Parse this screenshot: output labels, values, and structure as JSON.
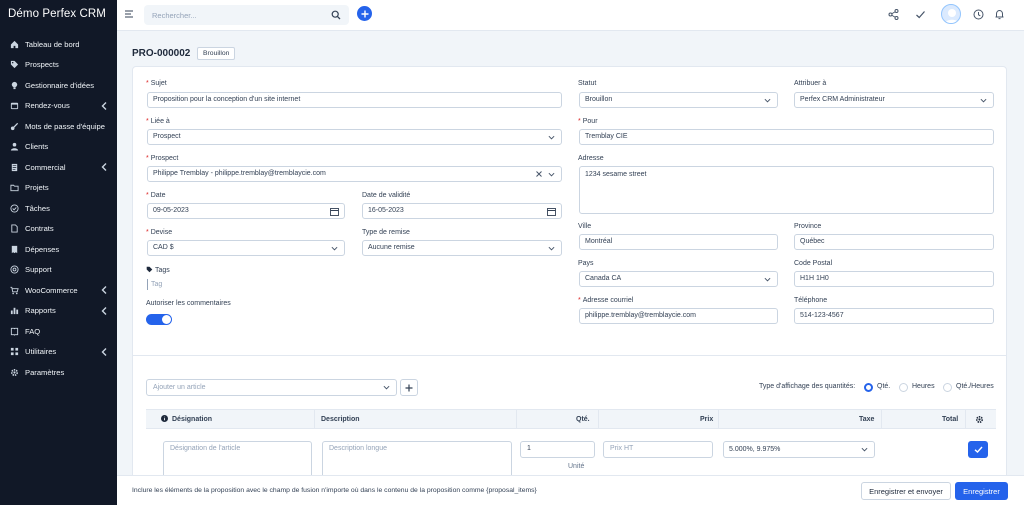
{
  "app": {
    "brand": "Démo Perfex CRM"
  },
  "sidebar": {
    "items": [
      {
        "label": "Tableau de bord",
        "icon": "home-icon",
        "has_sub": false
      },
      {
        "label": "Prospects",
        "icon": "tag-icon",
        "has_sub": false
      },
      {
        "label": "Gestionnaire d'idées",
        "icon": "lightbulb-icon",
        "has_sub": false
      },
      {
        "label": "Rendez-vous",
        "icon": "calendar-icon",
        "has_sub": true
      },
      {
        "label": "Mots de passe d'équipe",
        "icon": "key-icon",
        "has_sub": false
      },
      {
        "label": "Clients",
        "icon": "user-icon",
        "has_sub": false
      },
      {
        "label": "Commercial",
        "icon": "document-icon",
        "has_sub": true
      },
      {
        "label": "Projets",
        "icon": "folder-icon",
        "has_sub": false
      },
      {
        "label": "Tâches",
        "icon": "check-circle-icon",
        "has_sub": false
      },
      {
        "label": "Contrats",
        "icon": "file-icon",
        "has_sub": false
      },
      {
        "label": "Dépenses",
        "icon": "receipt-icon",
        "has_sub": false
      },
      {
        "label": "Support",
        "icon": "lifebuoy-icon",
        "has_sub": false
      },
      {
        "label": "WooCommerce",
        "icon": "cart-icon",
        "has_sub": true
      },
      {
        "label": "Rapports",
        "icon": "chart-icon",
        "has_sub": true
      },
      {
        "label": "FAQ",
        "icon": "book-icon",
        "has_sub": false
      },
      {
        "label": "Utilitaires",
        "icon": "grid-icon",
        "has_sub": true
      },
      {
        "label": "Paramètres",
        "icon": "gear-icon",
        "has_sub": false
      }
    ]
  },
  "topbar": {
    "search_placeholder": "Rechercher...",
    "icons": [
      "menu-icon",
      "search-icon",
      "plus-icon",
      "share-icon",
      "check-icon",
      "avatar",
      "clock-icon",
      "bell-icon"
    ]
  },
  "proposal": {
    "number": "PRO-000002",
    "status_badge": "Brouillon"
  },
  "form": {
    "subject": {
      "label": "Sujet",
      "value": "Proposition pour la conception d'un site internet"
    },
    "related": {
      "label": "Liée à",
      "value": "Prospect"
    },
    "prospect": {
      "label": "Prospect",
      "value": "Philippe Tremblay - philippe.tremblay@tremblaycie.com"
    },
    "date": {
      "label": "Date",
      "value": "09-05-2023"
    },
    "open_till": {
      "label": "Date de validité",
      "value": "16-05-2023"
    },
    "currency": {
      "label": "Devise",
      "value": "CAD $"
    },
    "discount_type": {
      "label": "Type de remise",
      "value": "Aucune remise"
    },
    "tags": {
      "label": "Tags",
      "placeholder": "Tag"
    },
    "allow_comments": {
      "label": "Autoriser les commentaires",
      "enabled": true
    },
    "status": {
      "label": "Statut",
      "value": "Brouillon"
    },
    "assigned": {
      "label": "Attribuer à",
      "value": "Perfex CRM Administrateur"
    },
    "to": {
      "label": "Pour",
      "value": "Tremblay CIE"
    },
    "address": {
      "label": "Adresse",
      "value": "1234 sesame street"
    },
    "city": {
      "label": "Ville",
      "value": "Montréal"
    },
    "state": {
      "label": "Province",
      "value": "Québec"
    },
    "country": {
      "label": "Pays",
      "value": "Canada CA"
    },
    "zip": {
      "label": "Code Postal",
      "value": "H1H 1H0"
    },
    "email": {
      "label": "Adresse courriel",
      "value": "philippe.tremblay@tremblaycie.com"
    },
    "phone": {
      "label": "Téléphone",
      "value": "514-123-4567"
    }
  },
  "items": {
    "add_placeholder": "Ajouter un article",
    "qty_mode_label": "Type d'affichage des quantités:",
    "qty_modes": [
      {
        "label": "Qté.",
        "selected": true
      },
      {
        "label": "Heures",
        "selected": false
      },
      {
        "label": "Qté./Heures",
        "selected": false
      }
    ],
    "columns": {
      "designation": "Désignation",
      "description": "Description",
      "qty": "Qté.",
      "price": "Prix",
      "tax": "Taxe",
      "total": "Total"
    },
    "new_row": {
      "designation_placeholder": "Désignation de l'article",
      "description_placeholder": "Description longue",
      "qty_value": "1",
      "unit_placeholder": "Unité",
      "price_placeholder": "Prix HT",
      "tax_value": "5.000%, 9.975%"
    }
  },
  "footer": {
    "hint": "Inclure les éléments de la proposition avec le champ de fusion n'importe où dans le contenu de la proposition comme {proposal_items}",
    "save_send": "Enregistrer et envoyer",
    "save": "Enregistrer"
  },
  "colors": {
    "sidebar_bg": "#111827",
    "accent": "#2563eb",
    "required": "#dc2626"
  }
}
